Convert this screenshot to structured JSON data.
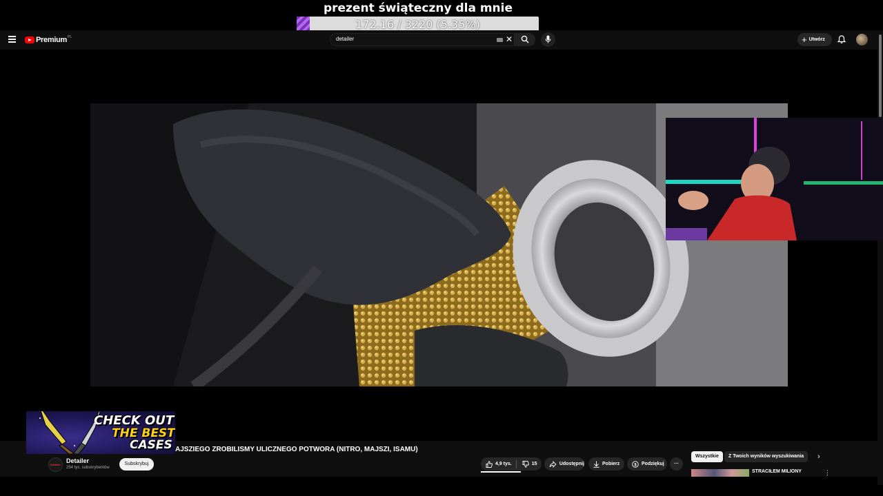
{
  "stream_goal": {
    "title": "prezent świąteczny dla mnie",
    "progress_text": "172.16 / 3220 (5.35%)",
    "current": 172.16,
    "target": 3220,
    "percent": 5.35,
    "fill_color": "#7b2fbf"
  },
  "header": {
    "logo_text": "Premium",
    "logo_region": "PL",
    "search": {
      "value": "detailer"
    },
    "create_label": "Utwórz",
    "icons": [
      "menu-icon",
      "search-icon",
      "mic-icon",
      "bell-icon",
      "keyboard-icon",
      "close-icon"
    ]
  },
  "video": {
    "title": "AJSZIEGO ZROBILISMY ULICZNEGO POTWORA (NITRO, MAJSZI, ISAMU)",
    "channel": {
      "name": "Detailer",
      "subscribers": "254 tys. subskrybentów",
      "avatar_text": "Detailer"
    },
    "subscribe_label": "Subskrybuj",
    "actions": {
      "likes": "4,9 tys.",
      "dislikes": "15",
      "share": "Udostępnij",
      "download": "Pobierz",
      "thanks": "Podziękuj"
    }
  },
  "sidebar": {
    "chips": [
      "Wszystkie",
      "Z Twoich wyników wyszukiwania"
    ],
    "recommended": [
      {
        "title": "STRACIŁEM MILIONY"
      }
    ]
  },
  "promo": {
    "line1": "CHECK OUT",
    "line2a": "THE BEST",
    "line2b": "CASES"
  },
  "colors": {
    "brand_red": "#ff0000",
    "background": "#0f0f0f",
    "promo_yellow": "#ffd21a"
  }
}
